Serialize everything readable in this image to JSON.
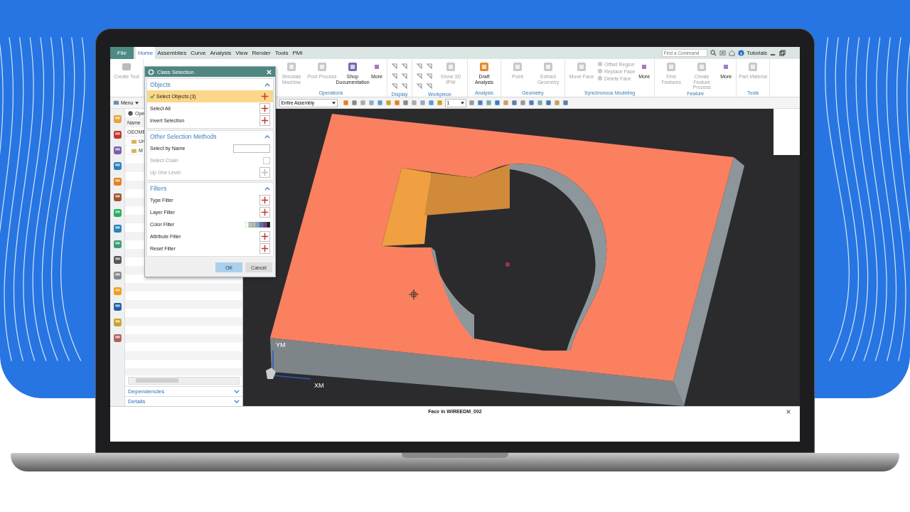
{
  "menu_tabs": [
    {
      "label": "File",
      "kind": "file",
      "selected": false
    },
    {
      "label": "Home",
      "kind": "tab",
      "selected": true
    },
    {
      "label": "Assemblies",
      "kind": "tab",
      "selected": false
    },
    {
      "label": "Curve",
      "kind": "tab",
      "selected": false
    },
    {
      "label": "Analysis",
      "kind": "tab",
      "selected": false
    },
    {
      "label": "View",
      "kind": "tab",
      "selected": false
    },
    {
      "label": "Render",
      "kind": "tab",
      "selected": false
    },
    {
      "label": "Tools",
      "kind": "tab",
      "selected": false
    },
    {
      "label": "PMI",
      "kind": "tab",
      "selected": false
    }
  ],
  "command_search": {
    "placeholder": "Find a Command"
  },
  "tutorials": "Tutorials",
  "ribbon_lead": [
    {
      "label": "Create Tool",
      "disabled": true
    }
  ],
  "ribbon_groups": [
    {
      "label": "Operations",
      "items": [
        {
          "kind": "large",
          "label": "Simulate Machine",
          "disabled": true
        },
        {
          "kind": "large",
          "label": "Post Process",
          "disabled": true
        },
        {
          "kind": "large",
          "label": "Shop Documentation",
          "disabled": false
        },
        {
          "kind": "more",
          "label": "More",
          "disabled": false
        }
      ]
    },
    {
      "label": "Display",
      "items": [
        {
          "kind": "grid",
          "disabled": false
        }
      ]
    },
    {
      "label": "Workpiece",
      "items": [
        {
          "kind": "grid",
          "disabled": false
        },
        {
          "kind": "large",
          "label": "Show 3D IPW",
          "disabled": true
        }
      ]
    },
    {
      "label": "Analysis",
      "items": [
        {
          "kind": "large",
          "label": "Draft Analysis",
          "disabled": false
        }
      ]
    },
    {
      "label": "Geometry",
      "items": [
        {
          "kind": "large",
          "label": "Point",
          "disabled": true
        },
        {
          "kind": "large",
          "label": "Extract Geometry",
          "disabled": true
        }
      ]
    },
    {
      "label": "Synchronous Modeling",
      "items": [
        {
          "kind": "large",
          "label": "Move Face",
          "disabled": true
        },
        {
          "kind": "stack",
          "labels": [
            "Offset Region",
            "Replace Face",
            "Delete Face"
          ],
          "disabled": true
        },
        {
          "kind": "more",
          "label": "More",
          "disabled": false
        }
      ]
    },
    {
      "label": "Feature",
      "items": [
        {
          "kind": "large",
          "label": "Find Features",
          "disabled": true
        },
        {
          "kind": "large",
          "label": "Create Feature Process",
          "disabled": true
        },
        {
          "kind": "more",
          "label": "More",
          "disabled": false
        }
      ]
    },
    {
      "label": "Tools",
      "items": [
        {
          "kind": "large",
          "label": "Part Material",
          "disabled": true
        }
      ]
    }
  ],
  "toolbar": {
    "menu": "Menu",
    "assembly": "Entire Assembly",
    "layer": "1"
  },
  "navigator": {
    "title": "Ope",
    "column": "Name",
    "tree": [
      {
        "label": "GEOME",
        "children": [
          {
            "label": "Un"
          },
          {
            "label": "M"
          }
        ]
      }
    ],
    "sections": [
      {
        "label": "Dependencies",
        "expanded": false
      },
      {
        "label": "Details",
        "expanded": false
      }
    ]
  },
  "viewport": {
    "axis_labels": [
      "YM",
      "XM"
    ]
  },
  "dialog": {
    "title": "Class Selection",
    "groups": [
      {
        "label": "Objects",
        "expanded": true,
        "rows": [
          {
            "kind": "button",
            "label": "Select Objects (3)",
            "selected": true,
            "disabled": false
          },
          {
            "kind": "button",
            "label": "Select All",
            "selected": false,
            "disabled": false
          },
          {
            "kind": "button",
            "label": "Invert Selection",
            "selected": false,
            "disabled": false
          }
        ]
      },
      {
        "label": "Other Selection Methods",
        "expanded": true,
        "rows": [
          {
            "kind": "field",
            "label": "Select by Name",
            "selected": false,
            "disabled": false
          },
          {
            "kind": "checkbox",
            "label": "Select Chain",
            "selected": false,
            "disabled": true,
            "checked": false
          },
          {
            "kind": "button",
            "label": "Up One Level",
            "selected": false,
            "disabled": true
          }
        ]
      },
      {
        "label": "Filters",
        "expanded": true,
        "rows": [
          {
            "kind": "button",
            "label": "Type Filter",
            "selected": false,
            "disabled": false
          },
          {
            "kind": "button",
            "label": "Layer Filter",
            "selected": false,
            "disabled": false
          },
          {
            "kind": "swatches",
            "label": "Color Filter",
            "selected": false,
            "disabled": false
          },
          {
            "kind": "button",
            "label": "Attribute Filter",
            "selected": false,
            "disabled": false
          },
          {
            "kind": "button",
            "label": "Reset Filter",
            "selected": false,
            "disabled": false
          }
        ]
      }
    ],
    "buttons": [
      {
        "label": "OK",
        "default": true
      },
      {
        "label": "Cancel",
        "default": false
      }
    ]
  },
  "status_bar": {
    "message": "Face in WIREEDM_002"
  }
}
